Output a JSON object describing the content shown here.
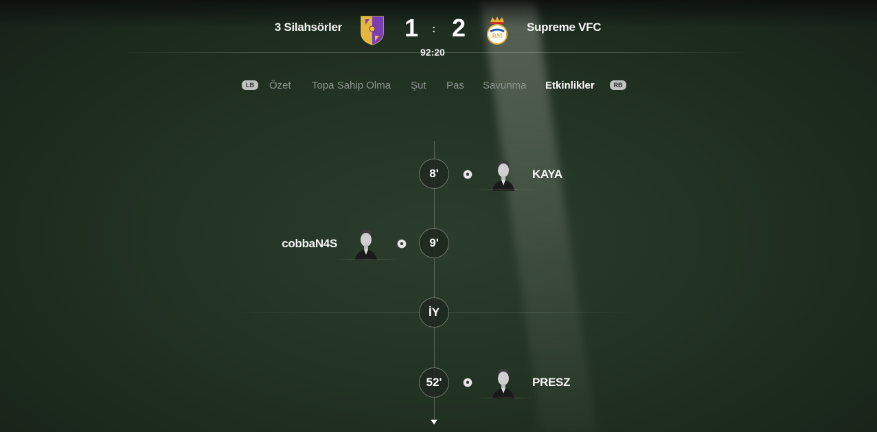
{
  "match": {
    "home": {
      "name": "3 Silahsörler",
      "score": "1",
      "crest_colors": [
        "#7b3fb3",
        "#f2c230"
      ]
    },
    "away": {
      "name": "Supreme VFC",
      "score": "2",
      "crest_colors": [
        "#ffffff",
        "#e5b13a"
      ]
    },
    "separator": ":",
    "clock": "92:20"
  },
  "tabs": {
    "left_shoulder": "LB",
    "right_shoulder": "RB",
    "items": [
      {
        "label": "Özet",
        "active": false
      },
      {
        "label": "Topa Sahip Olma",
        "active": false
      },
      {
        "label": "Şut",
        "active": false
      },
      {
        "label": "Pas",
        "active": false
      },
      {
        "label": "Savunma",
        "active": false
      },
      {
        "label": "Etkinlikler",
        "active": true
      }
    ]
  },
  "events": [
    {
      "minute": "8'",
      "type": "goal",
      "side": "away",
      "player": "KAYA",
      "icon": "soccer-ball-icon"
    },
    {
      "minute": "9'",
      "type": "goal",
      "side": "home",
      "player": "cobbaN4S",
      "icon": "soccer-ball-icon"
    },
    {
      "minute": "İY",
      "type": "half-time",
      "side": "center"
    },
    {
      "minute": "52'",
      "type": "goal",
      "side": "away",
      "player": "PRESZ",
      "icon": "soccer-ball-icon"
    }
  ],
  "colors": {
    "active_tab": "#ffffff",
    "inactive_tab": "#8d9590",
    "pitch": "#223223"
  }
}
